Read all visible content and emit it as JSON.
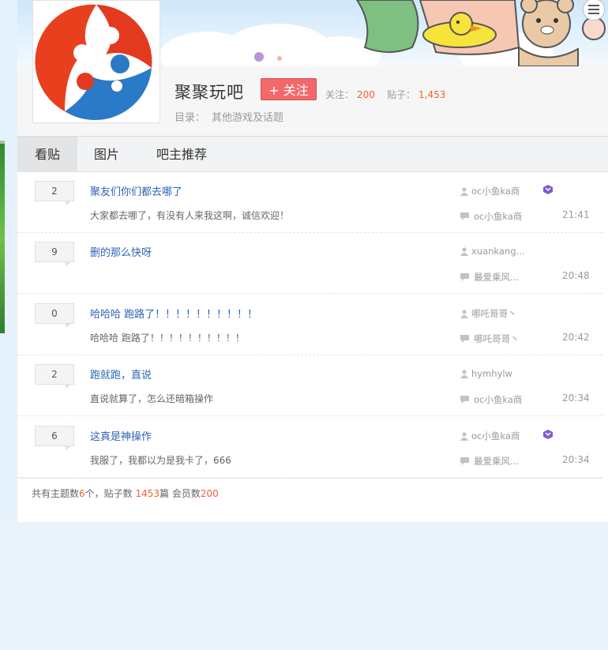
{
  "forum": {
    "name": "聚聚玩吧",
    "follow_label": "+ 关注",
    "follow_count_label": "关注：",
    "follow_count": "200",
    "post_count_label": "贴子：",
    "post_count": "1,453",
    "catalog_label": "目录：",
    "catalog_value": "其他游戏及话题",
    "logo_icon": "forum-logo-swirl"
  },
  "tabs": [
    {
      "label": "看贴",
      "active": true
    },
    {
      "label": "图片",
      "active": false
    },
    {
      "label": "吧主推荐",
      "active": false
    }
  ],
  "threads": [
    {
      "replies": "2",
      "title": "聚友们你们都去哪了",
      "abstract": "大家都去哪了，有没有人来我这啊，诚信欢迎！",
      "author": "oc小鱼ka商",
      "last_replier": "oc小鱼ka商",
      "time": "21:41",
      "badge": true
    },
    {
      "replies": "9",
      "title": "删的那么快呀",
      "abstract": "",
      "author": "xuankang...",
      "last_replier": "最爱乘风...",
      "time": "20:48",
      "badge": false
    },
    {
      "replies": "0",
      "title": "哈哈哈 跑路了！！！！！！！！！！",
      "abstract": "哈哈哈 跑路了！！！！！！！！！！",
      "author": "哪吒哥哥丶",
      "last_replier": "哪吒哥哥丶",
      "time": "20:42",
      "badge": false
    },
    {
      "replies": "2",
      "title": "跑就跑，直说",
      "abstract": "直说就算了，怎么还暗箱操作",
      "author": "hymhylw",
      "last_replier": "oc小鱼ka商",
      "time": "20:34",
      "badge": false
    },
    {
      "replies": "6",
      "title": "这真是神操作",
      "abstract": "我服了，我都以为是我卡了，666",
      "author": "oc小鱼ka商",
      "last_replier": "最爱乘风...",
      "time": "20:34",
      "badge": true
    }
  ],
  "footer": {
    "prefix": "共有主题数",
    "topics": "6",
    "mid1": "个，贴子数 ",
    "posts": "1453",
    "mid2": "篇 会员数",
    "members": "200"
  },
  "colors": {
    "accent": "#f36969",
    "link": "#2d64b3",
    "number": "#f0642a"
  }
}
